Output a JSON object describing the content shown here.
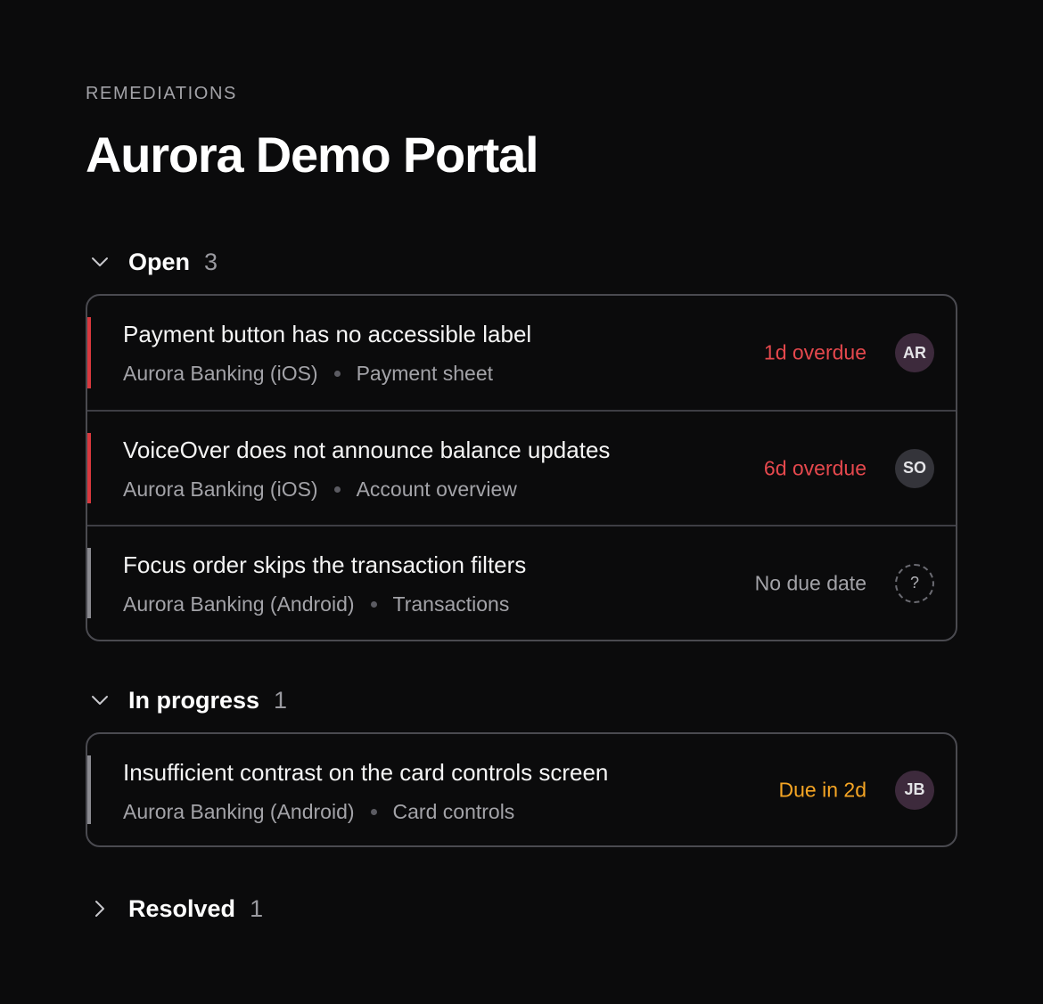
{
  "page": {
    "eyebrow": "REMEDIATIONS",
    "title": "Aurora Demo Portal"
  },
  "colors": {
    "overdue": "#e5484d",
    "due_soon": "#f5a524",
    "neutral": "#a3a3a8",
    "bar_red": "#d9383e",
    "bar_grey": "#8a8a90"
  },
  "groups": [
    {
      "label": "Open",
      "count": "3",
      "expanded": true,
      "chevron_icon": "chevron-down-icon",
      "items": [
        {
          "title": "Payment button has no accessible label",
          "app": "Aurora Banking (iOS)",
          "screen": "Payment sheet",
          "due": "1d overdue",
          "due_status": "overdue",
          "priority_bar": "red",
          "assignee": "AR",
          "avatar_color": "#3d2a3c"
        },
        {
          "title": "VoiceOver does not announce balance updates",
          "app": "Aurora Banking (iOS)",
          "screen": "Account overview",
          "due": "6d overdue",
          "due_status": "overdue",
          "priority_bar": "red",
          "assignee": "SO",
          "avatar_color": "#34343a"
        },
        {
          "title": "Focus order skips the transaction filters",
          "app": "Aurora Banking (Android)",
          "screen": "Transactions",
          "due": "No due date",
          "due_status": "none",
          "priority_bar": "grey",
          "assignee": "?",
          "avatar_color": "transparent"
        }
      ]
    },
    {
      "label": "In progress",
      "count": "1",
      "expanded": true,
      "chevron_icon": "chevron-down-icon",
      "items": [
        {
          "title": "Insufficient contrast on the card controls screen",
          "app": "Aurora Banking (Android)",
          "screen": "Card controls",
          "due": "Due in 2d",
          "due_status": "soon",
          "priority_bar": "grey",
          "assignee": "JB",
          "avatar_color": "#3d2a3c"
        }
      ]
    },
    {
      "label": "Resolved",
      "count": "1",
      "expanded": false,
      "chevron_icon": "chevron-right-icon"
    }
  ]
}
